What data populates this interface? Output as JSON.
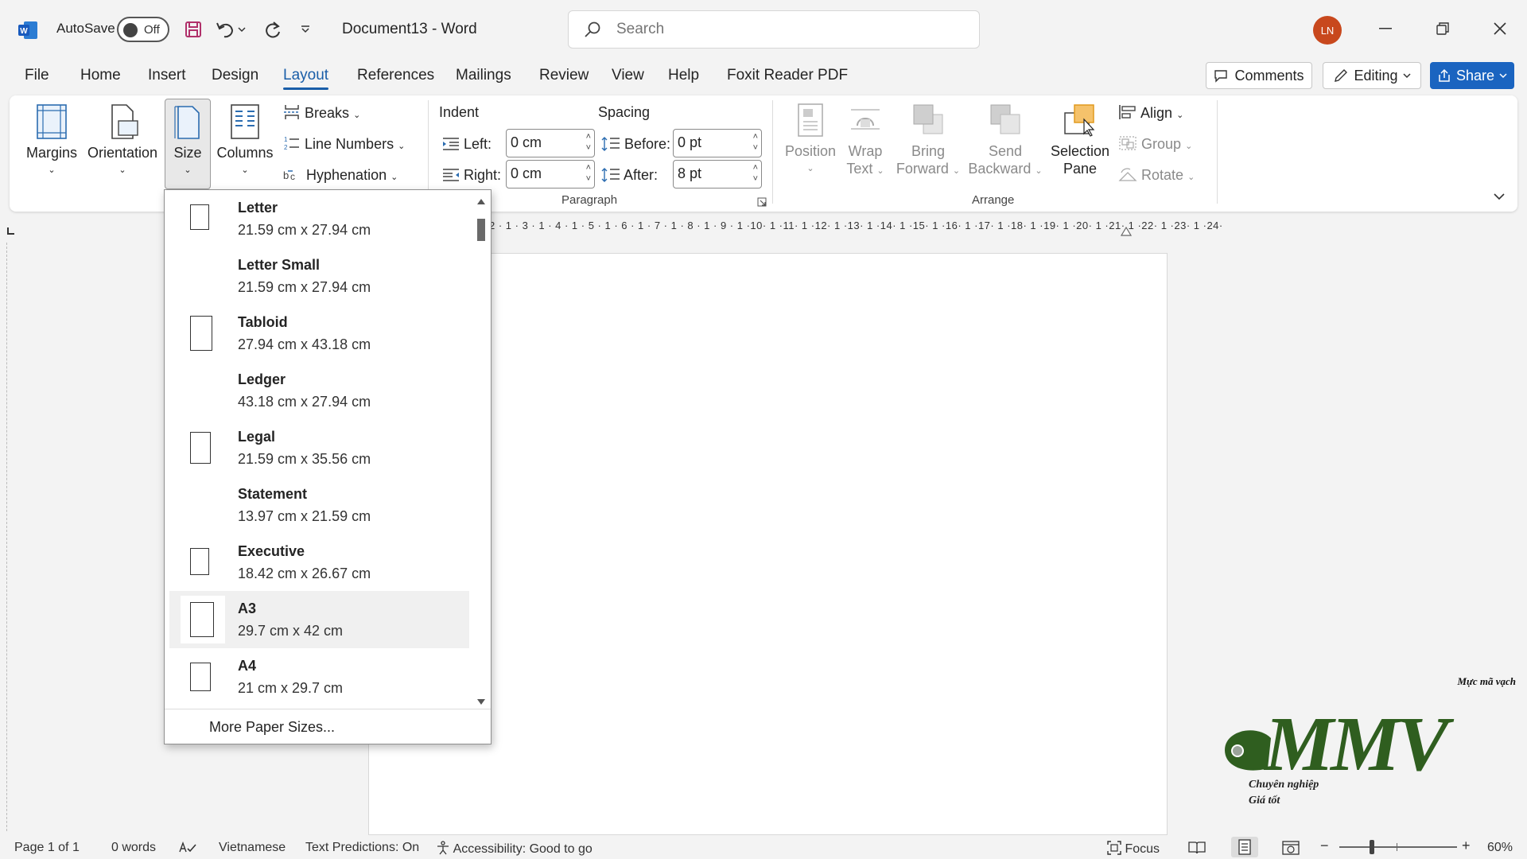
{
  "titlebar": {
    "autosave_label": "AutoSave",
    "autosave_state": "Off",
    "document_name": "Document13  -  Word",
    "search_placeholder": "Search",
    "user_initials": "LN"
  },
  "tabs": [
    "File",
    "Home",
    "Insert",
    "Design",
    "Layout",
    "References",
    "Mailings",
    "Review",
    "View",
    "Help",
    "Foxit Reader PDF"
  ],
  "active_tab": "Layout",
  "actions": {
    "comments": "Comments",
    "editing": "Editing",
    "share": "Share"
  },
  "ribbon": {
    "page_setup": {
      "margins": "Margins",
      "orientation": "Orientation",
      "size": "Size",
      "columns": "Columns",
      "breaks": "Breaks",
      "line_numbers": "Line Numbers",
      "hyphenation": "Hyphenation"
    },
    "paragraph": {
      "indent_title": "Indent",
      "spacing_title": "Spacing",
      "left_label": "Left:",
      "left_value": "0 cm",
      "right_label": "Right:",
      "right_value": "0 cm",
      "before_label": "Before:",
      "before_value": "0 pt",
      "after_label": "After:",
      "after_value": "8 pt",
      "group_label": "Paragraph"
    },
    "arrange": {
      "position": "Position",
      "wrap_text_1": "Wrap",
      "wrap_text_2": "Text",
      "bring_forward_1": "Bring",
      "bring_forward_2": "Forward",
      "send_backward_1": "Send",
      "send_backward_2": "Backward",
      "selection_pane_1": "Selection",
      "selection_pane_2": "Pane",
      "align": "Align",
      "group": "Group",
      "rotate": "Rotate",
      "group_label": "Arrange"
    }
  },
  "ruler_text": "2 · 1 · 3 · 1 · 4 · 1 · 5 · 1 · 6 · 1 · 7 · 1 · 8 · 1 · 9 · 1 ·10· 1 ·11· 1 ·12· 1 ·13· 1 ·14· 1 ·15· 1 ·16· 1 ·17· 1 ·18· 1 ·19· 1 ·20· 1 ·21· 1 ·22· 1 ·23· 1 ·24·",
  "size_dropdown": {
    "items": [
      {
        "name": "Letter",
        "dims": "21.59 cm x 27.94 cm",
        "icon": "portrait-page-icon"
      },
      {
        "name": "Letter Small",
        "dims": "21.59 cm x 27.94 cm",
        "icon": "none"
      },
      {
        "name": "Tabloid",
        "dims": "27.94 cm x 43.18 cm",
        "icon": "portrait-page-icon"
      },
      {
        "name": "Ledger",
        "dims": "43.18 cm x 27.94 cm",
        "icon": "none"
      },
      {
        "name": "Legal",
        "dims": "21.59 cm x 35.56 cm",
        "icon": "portrait-page-icon"
      },
      {
        "name": "Statement",
        "dims": "13.97 cm x 21.59 cm",
        "icon": "none"
      },
      {
        "name": "Executive",
        "dims": "18.42 cm x 26.67 cm",
        "icon": "portrait-page-icon"
      },
      {
        "name": "A3",
        "dims": "29.7 cm x 42 cm",
        "icon": "portrait-page-icon"
      },
      {
        "name": "A4",
        "dims": "21 cm x 29.7 cm",
        "icon": "portrait-page-icon"
      }
    ],
    "hovered": "A3",
    "more": "More Paper Sizes..."
  },
  "logo": {
    "tagline_top": "Mực mã vạch",
    "letters": "MMV",
    "tagline_1": "Chuyên nghiệp",
    "tagline_2": "Giá tốt"
  },
  "status": {
    "page": "Page 1 of 1",
    "words": "0 words",
    "language": "Vietnamese",
    "predictions": "Text Predictions: On",
    "accessibility": "Accessibility: Good to go",
    "focus": "Focus",
    "zoom": "60%"
  },
  "colors": {
    "accent": "#1a5ea8",
    "share": "#1a64c0",
    "avatar": "#c8481d",
    "logo_green": "#2f5e1f"
  }
}
